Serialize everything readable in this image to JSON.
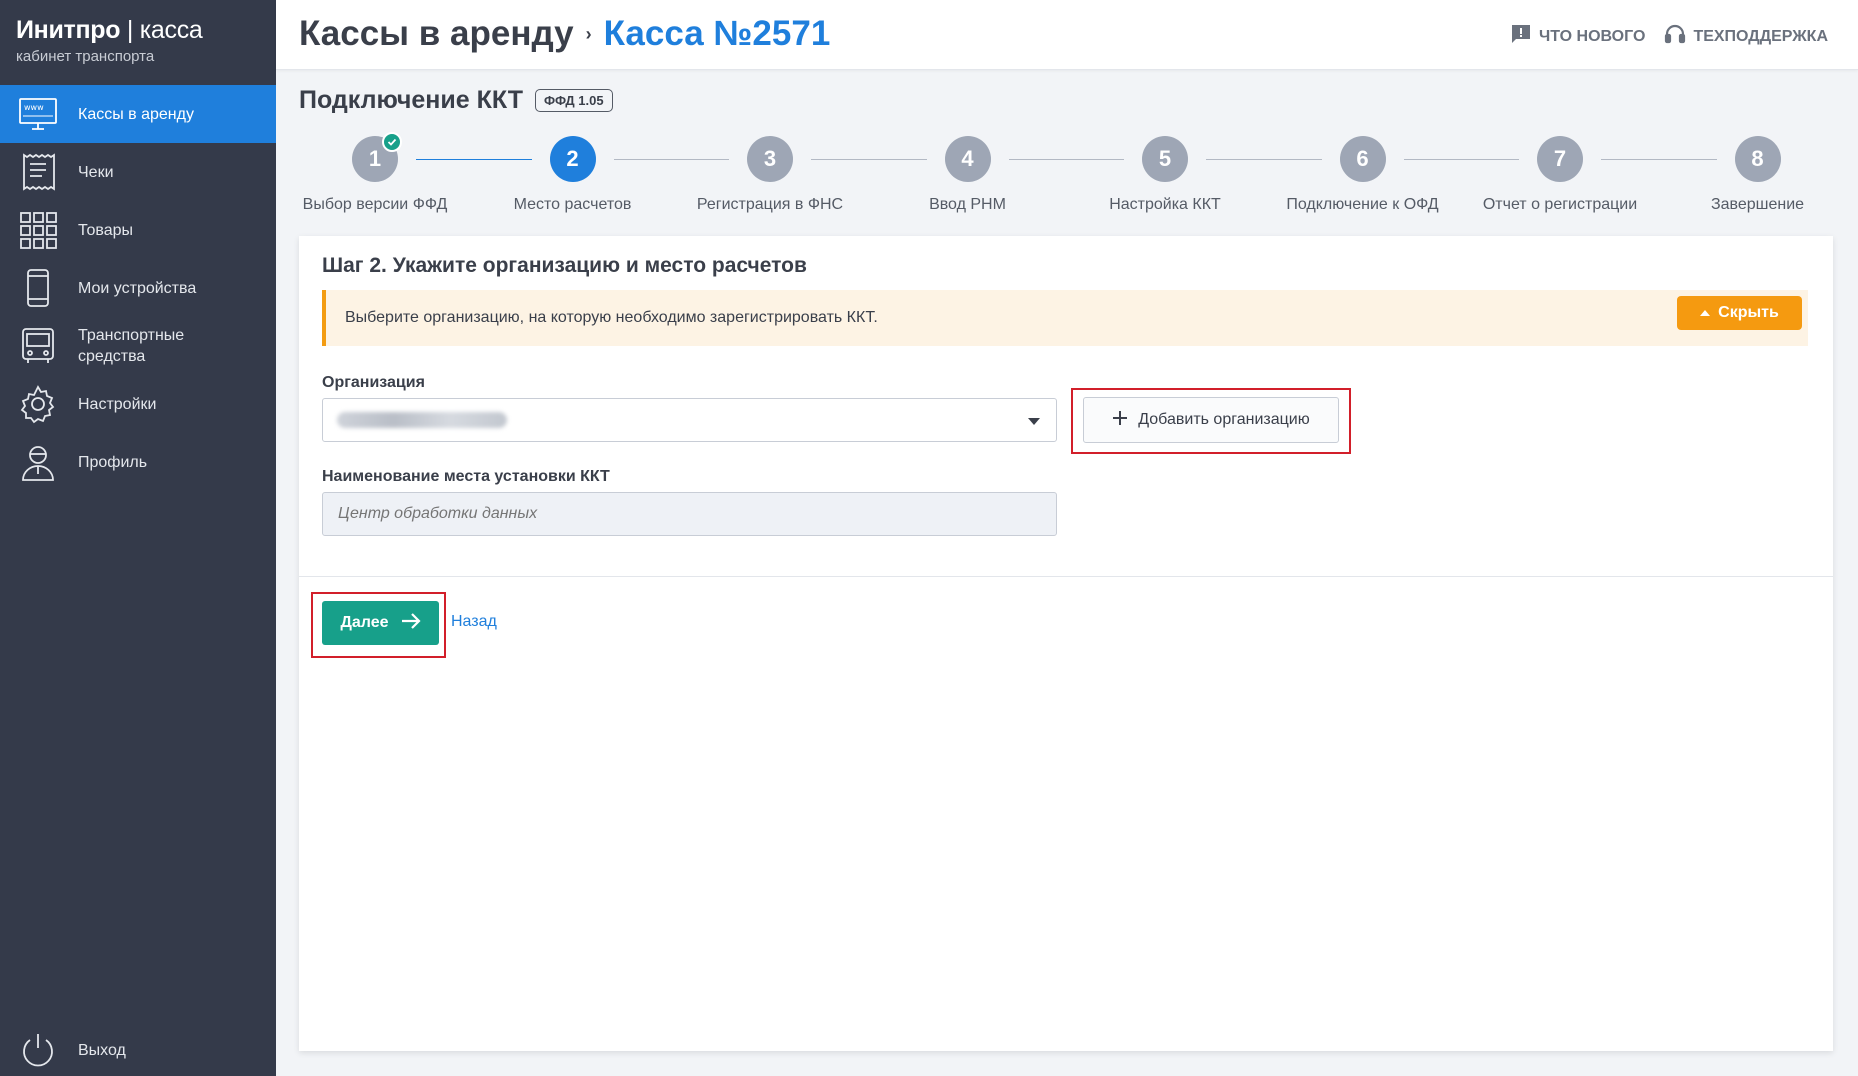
{
  "brand": {
    "name_bold": "Инитпро",
    "name_light": "| касса",
    "subtitle": "кабинет транспорта"
  },
  "sidebar": {
    "items": [
      {
        "label": "Кассы в аренду",
        "icon": "monitor-www-icon",
        "active": true
      },
      {
        "label": "Чеки",
        "icon": "receipt-icon"
      },
      {
        "label": "Товары",
        "icon": "grid-icon"
      },
      {
        "label": "Мои устройства",
        "icon": "phone-icon"
      },
      {
        "label": "Транспортные средства",
        "icon": "bus-icon"
      },
      {
        "label": "Настройки",
        "icon": "gear-icon"
      },
      {
        "label": "Профиль",
        "icon": "user-icon"
      }
    ],
    "logout": {
      "label": "Выход",
      "icon": "power-icon"
    }
  },
  "header": {
    "crumb_root": "Кассы в аренду",
    "crumb_sep": "›",
    "crumb_current": "Касса №2571",
    "whats_new": "ЧТО НОВОГО",
    "support": "ТЕХПОДДЕРЖКА"
  },
  "page": {
    "title": "Подключение ККТ",
    "badge": "ФФД 1.05"
  },
  "stepper": {
    "current": 2,
    "steps": [
      {
        "num": "1",
        "label": "Выбор версии ФФД",
        "done": true
      },
      {
        "num": "2",
        "label": "Место расчетов"
      },
      {
        "num": "3",
        "label": "Регистрация в ФНС"
      },
      {
        "num": "4",
        "label": "Ввод РНМ"
      },
      {
        "num": "5",
        "label": "Настройка ККТ"
      },
      {
        "num": "6",
        "label": "Подключение к ОФД"
      },
      {
        "num": "7",
        "label": "Отчет о регистрации"
      },
      {
        "num": "8",
        "label": "Завершение"
      }
    ]
  },
  "form": {
    "heading": "Шаг 2. Укажите организацию и место расчетов",
    "notice": "Выберите организацию, на которую необходимо зарегистрировать ККТ.",
    "hide_label": "Скрыть",
    "org_label": "Организация",
    "add_org_label": "Добавить организацию",
    "place_label": "Наименование места установки ККТ",
    "place_placeholder": "Центр обработки данных",
    "next_label": "Далее",
    "back_label": "Назад"
  },
  "colors": {
    "accent": "#1f7fdc",
    "sidebar": "#343a4a",
    "success": "#17a08a",
    "warning": "#f59a10",
    "highlight": "#d21f2a"
  }
}
